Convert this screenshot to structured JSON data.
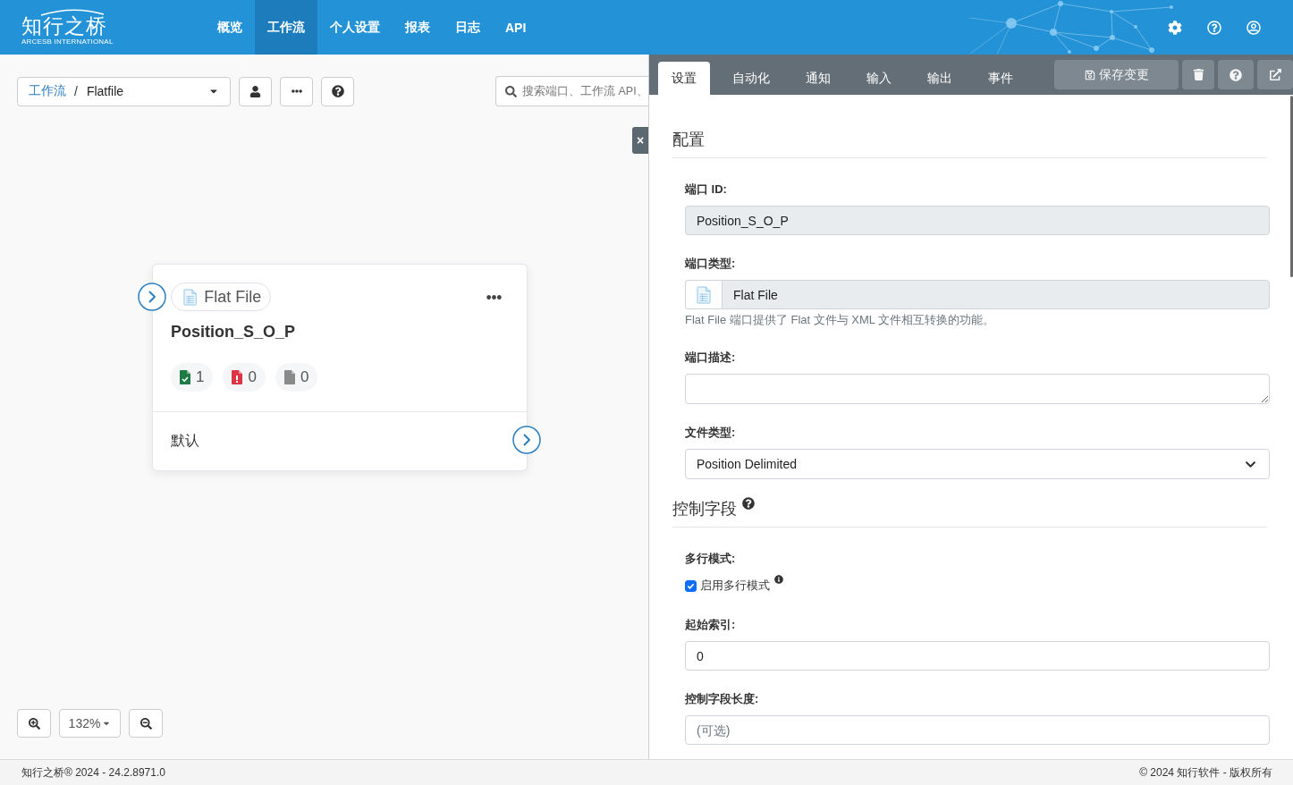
{
  "header": {
    "logo": {
      "name": "知行之桥",
      "tagline": "ARCESB INTERNATIONAL"
    },
    "nav": [
      {
        "label": "概览",
        "selected": false
      },
      {
        "label": "工作流",
        "selected": true
      },
      {
        "label": "个人设置",
        "selected": false
      },
      {
        "label": "报表",
        "selected": false
      },
      {
        "label": "日志",
        "selected": false
      },
      {
        "label": "API",
        "selected": false
      }
    ]
  },
  "toolbar": {
    "breadcrumb": {
      "link": "工作流",
      "separator": "/",
      "current": "Flatfile"
    },
    "search": {
      "placeholder": "搜索端口、工作流 API、"
    }
  },
  "panel_toggle": {
    "label": "×"
  },
  "node": {
    "type_label": "Flat File",
    "title": "Position_S_O_P",
    "counts": [
      {
        "kind": "success",
        "value": "1"
      },
      {
        "kind": "error",
        "value": "0"
      },
      {
        "kind": "pending",
        "value": "0"
      }
    ],
    "output": "默认"
  },
  "zoom": {
    "value": "132%"
  },
  "panel": {
    "tabs": [
      {
        "label": "设置",
        "selected": true
      },
      {
        "label": "自动化",
        "selected": false
      },
      {
        "label": "通知",
        "selected": false
      },
      {
        "label": "输入",
        "selected": false
      },
      {
        "label": "输出",
        "selected": false
      },
      {
        "label": "事件",
        "selected": false
      }
    ],
    "save_label": "保存变更",
    "sections": [
      {
        "title": "配置",
        "fields": [
          {
            "kind": "readonly",
            "label": "端口 ID:",
            "value": "Position_S_O_P"
          },
          {
            "kind": "icon_readonly",
            "label": "端口类型:",
            "value": "Flat File",
            "hint": "Flat File 端口提供了 Flat 文件与 XML 文件相互转换的功能。"
          },
          {
            "kind": "textarea",
            "label": "端口描述:"
          },
          {
            "kind": "select",
            "label": "文件类型:",
            "value": "Position Delimited"
          }
        ]
      },
      {
        "title": "控制字段",
        "help": true,
        "fields": [
          {
            "kind": "checkbox",
            "label": "多行模式:",
            "option": "启用多行模式",
            "checked": true,
            "info": true
          },
          {
            "kind": "text",
            "label": "起始索引:",
            "value": "0"
          },
          {
            "kind": "text",
            "label": "控制字段长度:",
            "placeholder": "(可选)"
          }
        ]
      }
    ]
  },
  "footer": {
    "left": "知行之桥® 2024 - 24.2.8971.0",
    "right": "© 2024 知行软件 - 版权所有"
  }
}
